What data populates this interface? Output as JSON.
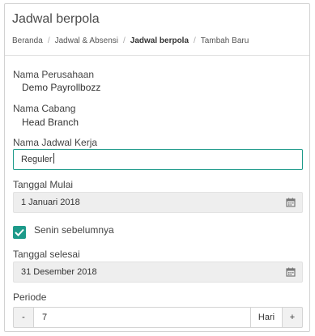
{
  "page": {
    "title": "Jadwal berpola"
  },
  "breadcrumb": [
    "Beranda",
    "Jadwal & Absensi",
    "Jadwal berpola",
    "Tambah Baru"
  ],
  "form": {
    "company": {
      "label": "Nama Perusahaan",
      "value": "Demo Payrollbozz"
    },
    "branch": {
      "label": "Nama Cabang",
      "value": "Head Branch"
    },
    "schedule_name": {
      "label": "Nama Jadwal Kerja",
      "value": "Reguler"
    },
    "start_date": {
      "label": "Tanggal Mulai",
      "value": "1 Januari 2018",
      "icon": "calendar-icon"
    },
    "previous_monday": {
      "label": "Senin sebelumnya",
      "checked": true
    },
    "end_date": {
      "label": "Tanggal selesai",
      "value": "31 Desember 2018",
      "icon": "calendar-icon"
    },
    "period": {
      "label": "Periode",
      "value": "7",
      "unit": "Hari",
      "minus": "-",
      "plus": "+"
    }
  },
  "colors": {
    "accent": "#1d9a8a",
    "readonly_bg": "#eeeeee"
  }
}
